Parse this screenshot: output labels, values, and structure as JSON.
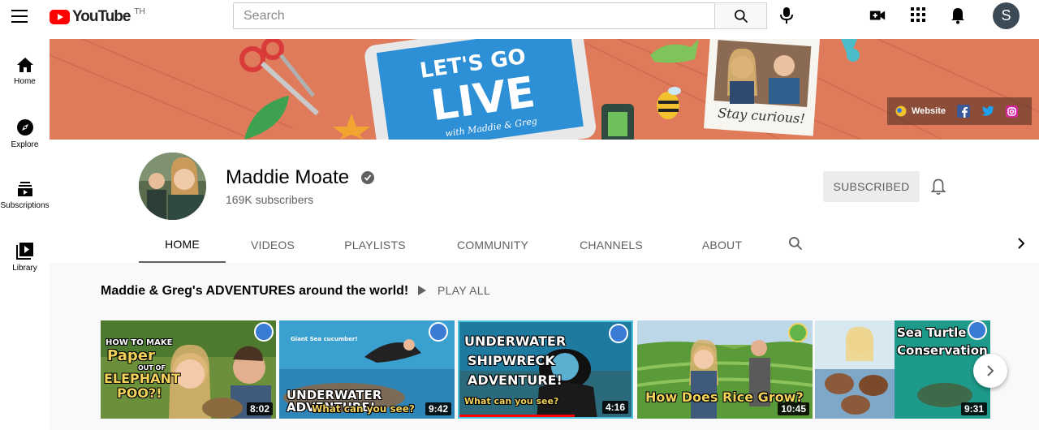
{
  "topbar": {
    "logo_text": "YouTube",
    "logo_country": "TH",
    "search_placeholder": "Search",
    "avatar_letter": "S"
  },
  "sidebar": {
    "items": [
      {
        "label": "Home",
        "icon": "home-icon"
      },
      {
        "label": "Explore",
        "icon": "compass-icon"
      },
      {
        "label": "Subscriptions",
        "icon": "subscriptions-icon"
      },
      {
        "label": "Library",
        "icon": "library-icon"
      }
    ]
  },
  "banner": {
    "headline_1": "LET'S GO",
    "headline_2": "LIVE",
    "byline": "with Maddie & Greg",
    "polaroid_caption": "Stay curious!",
    "links_label": "Website"
  },
  "channel": {
    "name": "Maddie Moate",
    "subscribers": "169K subscribers",
    "subscribe_label": "SUBSCRIBED"
  },
  "tabs": [
    {
      "label": "HOME",
      "active": true
    },
    {
      "label": "VIDEOS",
      "active": false
    },
    {
      "label": "PLAYLISTS",
      "active": false
    },
    {
      "label": "COMMUNITY",
      "active": false
    },
    {
      "label": "CHANNELS",
      "active": false
    },
    {
      "label": "ABOUT",
      "active": false
    }
  ],
  "section": {
    "title": "Maddie & Greg's ADVENTURES around the world!",
    "play_all_label": "PLAY ALL"
  },
  "videos": [
    {
      "duration": "8:02",
      "overlay_lines": [
        "HOW TO MAKE",
        "Paper",
        "OUT OF",
        "ELEPHANT",
        "POO?!"
      ]
    },
    {
      "duration": "9:42",
      "overlay_lines": [
        "Giant Sea cucumber!",
        "UNDERWATER ADVENTURE!",
        "What can you see?"
      ]
    },
    {
      "duration": "4:16",
      "overlay_lines": [
        "UNDERWATER",
        "SHIPWRECK",
        "ADVENTURE!",
        "What can you see?"
      ],
      "progress": 0.67
    },
    {
      "duration": "10:45",
      "overlay_lines": [
        "How Does Rice Grow?"
      ]
    },
    {
      "duration": "9:31",
      "overlay_lines": [
        "Sea Turtle",
        "Conservation"
      ]
    }
  ]
}
